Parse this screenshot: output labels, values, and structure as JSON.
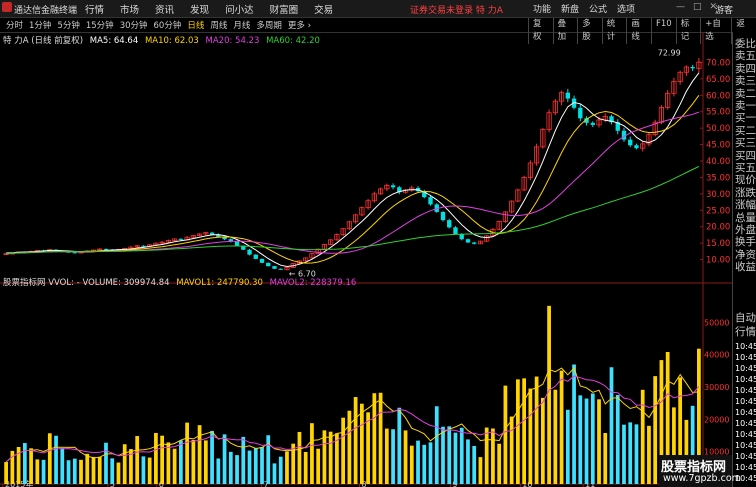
{
  "app": {
    "name": "通达信金融终端",
    "menus": [
      "行情",
      "市场",
      "资讯",
      "发现",
      "问小达",
      "财富圈",
      "交易"
    ],
    "login_status": "证券交易未登录",
    "stock_name": "特 力A",
    "right_menus": [
      "功能",
      "新盘",
      "公式",
      "选项"
    ],
    "window_controls": [
      "—",
      "□",
      "✕"
    ],
    "guest_label": "游客"
  },
  "periods": {
    "items": [
      "分时",
      "1分钟",
      "5分钟",
      "15分钟",
      "30分钟",
      "60分钟",
      "日线",
      "周线",
      "月线",
      "多周期",
      "更多 ›"
    ],
    "active": "日线"
  },
  "toolbar": [
    "复权",
    "叠加",
    "多股",
    "统计",
    "画线",
    "F10",
    "标记",
    "+自选",
    "返回"
  ],
  "price_legend": {
    "title": "特 力A (日线 前复权)",
    "ma5": "MA5: 64.64",
    "ma10": "MA10: 62.03",
    "ma20": "MA20: 54.23",
    "ma60": "MA60: 42.20"
  },
  "volume_legend": {
    "title": "股票指标网 VVOL: - VOLUME: 309974.84",
    "mavol1": "MAVOL1: 247790.30",
    "mavol2": "MAVOL2: 228379.16"
  },
  "annotations": {
    "high": "72.99",
    "low": "6.70"
  },
  "price_axis": [
    "70.00",
    "65.00",
    "60.00",
    "55.00",
    "50.00",
    "45.00",
    "40.00",
    "35.00",
    "30.00",
    "25.00",
    "20.00",
    "15.00",
    "10.00"
  ],
  "volume_axis": [
    "50000",
    "40000",
    "30000",
    "20000",
    "10000"
  ],
  "time_axis": [
    "2015年",
    "5",
    "6",
    "7",
    "8",
    "9",
    "10",
    "11"
  ],
  "right_panel": {
    "labels": [
      "委比",
      "卖五",
      "卖四",
      "卖三",
      "卖二",
      "卖一",
      "买一",
      "买二",
      "买三",
      "买四",
      "买五",
      "现价",
      "涨跌",
      "涨幅",
      "总量",
      "外盘",
      "换手",
      "净资",
      "收益"
    ],
    "lower": [
      "自动",
      "行情"
    ],
    "times": [
      "10:45",
      "10:45",
      "10:45",
      "10:45",
      "10:45",
      "10:45",
      "10:45",
      "10:45",
      "10:45",
      "10:45",
      "10:45",
      "10:45",
      "10:45"
    ]
  },
  "watermark": {
    "line1": "股票指标网",
    "line2": "www.7gpzb.com"
  },
  "colors": {
    "up": "#ff3030",
    "down": "#00e0e0",
    "ma5": "#ffffff",
    "ma10": "#ffd400",
    "ma20": "#e040e0",
    "ma60": "#30d030",
    "vol_up": "#ffd400",
    "vol_down": "#40e0ff"
  },
  "chart_data": {
    "type": "candlestick",
    "close": [
      11.8,
      12.0,
      12.3,
      12.1,
      12.5,
      12.8,
      12.6,
      13.0,
      12.7,
      12.4,
      12.2,
      12.0,
      12.3,
      12.6,
      12.9,
      13.2,
      13.0,
      12.8,
      13.1,
      13.4,
      13.8,
      14.2,
      14.0,
      14.5,
      15.0,
      15.3,
      15.8,
      16.3,
      16.0,
      16.8,
      17.3,
      17.8,
      18.2,
      17.6,
      16.9,
      16.2,
      15.5,
      14.2,
      13.0,
      11.5,
      10.2,
      9.0,
      8.0,
      7.2,
      6.9,
      7.6,
      8.8,
      9.6,
      10.5,
      11.8,
      13.2,
      14.6,
      16.0,
      17.6,
      19.4,
      21.5,
      23.6,
      25.8,
      27.9,
      30.0,
      31.5,
      32.6,
      32.0,
      30.5,
      31.2,
      31.8,
      30.8,
      29.0,
      26.8,
      24.5,
      22.0,
      19.8,
      17.8,
      16.2,
      15.2,
      14.8,
      15.6,
      17.2,
      19.2,
      21.6,
      24.5,
      27.8,
      31.2,
      35.0,
      39.4,
      44.3,
      49.6,
      54.7,
      58.2,
      60.8,
      59.0,
      56.2,
      53.0,
      51.6,
      51.0,
      52.5,
      53.6,
      51.8,
      49.2,
      46.5,
      44.8,
      43.9,
      45.2,
      48.0,
      51.8,
      56.3,
      60.6,
      64.2,
      67.0,
      68.6,
      68.2,
      70.1
    ],
    "ma5": [
      12.0,
      12.1,
      12.2,
      12.3,
      12.3,
      12.5,
      12.6,
      12.8,
      12.8,
      12.7,
      12.6,
      12.5,
      12.3,
      12.3,
      12.4,
      12.6,
      12.8,
      12.9,
      13.0,
      13.1,
      13.2,
      13.5,
      13.7,
      14.0,
      14.3,
      14.6,
      15.0,
      15.4,
      15.7,
      16.0,
      16.4,
      16.8,
      17.2,
      17.5,
      17.6,
      17.3,
      16.8,
      16.1,
      15.2,
      14.1,
      12.9,
      11.6,
      10.3,
      9.2,
      8.3,
      7.9,
      8.1,
      8.6,
      9.2,
      10.1,
      11.2,
      12.4,
      13.7,
      15.1,
      16.6,
      18.2,
      19.9,
      21.6,
      23.4,
      25.4,
      27.3,
      28.9,
      30.0,
      30.7,
      31.1,
      31.3,
      31.2,
      30.6,
      29.5,
      28.2,
      26.6,
      24.7,
      22.6,
      20.6,
      18.9,
      17.6,
      16.9,
      16.7,
      17.0,
      18.0,
      19.6,
      21.9,
      24.7,
      27.9,
      31.6,
      35.5,
      39.9,
      44.6,
      49.2,
      53.3,
      56.5,
      57.8,
      57.4,
      56.1,
      54.3,
      52.9,
      52.4,
      52.1,
      51.6,
      50.7,
      49.2,
      47.2,
      46.0,
      45.6,
      46.4,
      48.0,
      50.4,
      53.6,
      57.3,
      61.2,
      64.3,
      66.8
    ]
  }
}
